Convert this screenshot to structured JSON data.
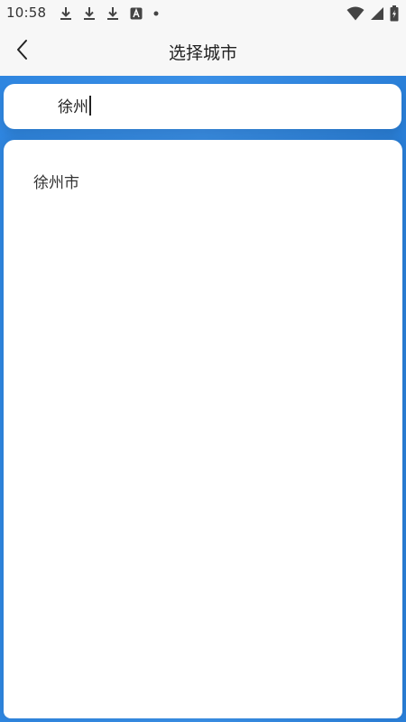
{
  "status_bar": {
    "time": "10:58",
    "left_icons": [
      "download-icon",
      "download-icon",
      "download-icon",
      "a-badge-icon",
      "dot-icon"
    ],
    "right_icons": [
      "wifi-icon",
      "cellular-signal-icon",
      "battery-charging-icon"
    ]
  },
  "header": {
    "title": "选择城市",
    "back_icon": "chevron-left-icon"
  },
  "search": {
    "value": "徐州",
    "placeholder": ""
  },
  "results": [
    {
      "label": "徐州市"
    }
  ],
  "colors": {
    "accent_blue": "#3a8fe6",
    "background": "#f7f7f7",
    "card": "#ffffff"
  }
}
